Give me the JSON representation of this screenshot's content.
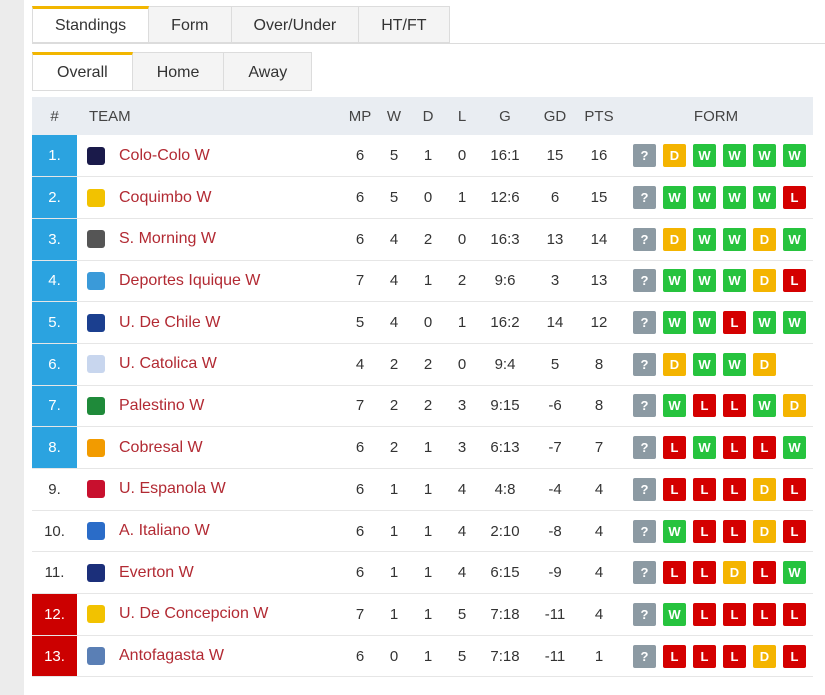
{
  "tabs": [
    "Standings",
    "Form",
    "Over/Under",
    "HT/FT"
  ],
  "subtabs": [
    "Overall",
    "Home",
    "Away"
  ],
  "headers": {
    "rank": "#",
    "team": "TEAM",
    "mp": "MP",
    "w": "W",
    "d": "D",
    "l": "L",
    "g": "G",
    "gd": "GD",
    "pts": "PTS",
    "form": "FORM"
  },
  "colors": {
    "champions": "#2ba3e0",
    "relegation": "#cc0000",
    "win": "#26c33e",
    "draw": "#f4b400",
    "loss": "#d40000",
    "next": "#8c9aa3",
    "team_link": "#b22a33"
  },
  "rows": [
    {
      "rank": "1.",
      "zone": "blue",
      "team": "Colo-Colo W",
      "logo_color": "#1a1a4a",
      "mp": "6",
      "w": "5",
      "d": "1",
      "l": "0",
      "g": "16:1",
      "gd": "15",
      "pts": "16",
      "form": [
        "?",
        "D",
        "W",
        "W",
        "W",
        "W"
      ]
    },
    {
      "rank": "2.",
      "zone": "blue",
      "team": "Coquimbo W",
      "logo_color": "#f2c200",
      "mp": "6",
      "w": "5",
      "d": "0",
      "l": "1",
      "g": "12:6",
      "gd": "6",
      "pts": "15",
      "form": [
        "?",
        "W",
        "W",
        "W",
        "W",
        "L"
      ]
    },
    {
      "rank": "3.",
      "zone": "blue",
      "team": "S. Morning W",
      "logo_color": "#555555",
      "mp": "6",
      "w": "4",
      "d": "2",
      "l": "0",
      "g": "16:3",
      "gd": "13",
      "pts": "14",
      "form": [
        "?",
        "D",
        "W",
        "W",
        "D",
        "W"
      ]
    },
    {
      "rank": "4.",
      "zone": "blue",
      "team": "Deportes Iquique W",
      "logo_color": "#3a9ad9",
      "mp": "7",
      "w": "4",
      "d": "1",
      "l": "2",
      "g": "9:6",
      "gd": "3",
      "pts": "13",
      "form": [
        "?",
        "W",
        "W",
        "W",
        "D",
        "L"
      ]
    },
    {
      "rank": "5.",
      "zone": "blue",
      "team": "U. De Chile W",
      "logo_color": "#1b3f8f",
      "mp": "5",
      "w": "4",
      "d": "0",
      "l": "1",
      "g": "16:2",
      "gd": "14",
      "pts": "12",
      "form": [
        "?",
        "W",
        "W",
        "L",
        "W",
        "W"
      ]
    },
    {
      "rank": "6.",
      "zone": "blue",
      "team": "U. Catolica W",
      "logo_color": "#c8d6ee",
      "mp": "4",
      "w": "2",
      "d": "2",
      "l": "0",
      "g": "9:4",
      "gd": "5",
      "pts": "8",
      "form": [
        "?",
        "D",
        "W",
        "W",
        "D"
      ]
    },
    {
      "rank": "7.",
      "zone": "blue",
      "team": "Palestino W",
      "logo_color": "#1f8a3a",
      "mp": "7",
      "w": "2",
      "d": "2",
      "l": "3",
      "g": "9:15",
      "gd": "-6",
      "pts": "8",
      "form": [
        "?",
        "W",
        "L",
        "L",
        "W",
        "D"
      ]
    },
    {
      "rank": "8.",
      "zone": "blue",
      "team": "Cobresal W",
      "logo_color": "#f29b00",
      "mp": "6",
      "w": "2",
      "d": "1",
      "l": "3",
      "g": "6:13",
      "gd": "-7",
      "pts": "7",
      "form": [
        "?",
        "L",
        "W",
        "L",
        "L",
        "W"
      ]
    },
    {
      "rank": "9.",
      "zone": "",
      "team": "U. Espanola W",
      "logo_color": "#c8102e",
      "mp": "6",
      "w": "1",
      "d": "1",
      "l": "4",
      "g": "4:8",
      "gd": "-4",
      "pts": "4",
      "form": [
        "?",
        "L",
        "L",
        "L",
        "D",
        "L"
      ]
    },
    {
      "rank": "10.",
      "zone": "",
      "team": "A. Italiano W",
      "logo_color": "#2a6cc8",
      "mp": "6",
      "w": "1",
      "d": "1",
      "l": "4",
      "g": "2:10",
      "gd": "-8",
      "pts": "4",
      "form": [
        "?",
        "W",
        "L",
        "L",
        "D",
        "L"
      ]
    },
    {
      "rank": "11.",
      "zone": "",
      "team": "Everton W",
      "logo_color": "#1b2f7a",
      "mp": "6",
      "w": "1",
      "d": "1",
      "l": "4",
      "g": "6:15",
      "gd": "-9",
      "pts": "4",
      "form": [
        "?",
        "L",
        "L",
        "D",
        "L",
        "W"
      ]
    },
    {
      "rank": "12.",
      "zone": "red",
      "team": "U. De Concepcion W",
      "logo_color": "#f2c200",
      "mp": "7",
      "w": "1",
      "d": "1",
      "l": "5",
      "g": "7:18",
      "gd": "-11",
      "pts": "4",
      "form": [
        "?",
        "W",
        "L",
        "L",
        "L",
        "L"
      ]
    },
    {
      "rank": "13.",
      "zone": "red",
      "team": "Antofagasta W",
      "logo_color": "#5a7fb5",
      "mp": "6",
      "w": "0",
      "d": "1",
      "l": "5",
      "g": "7:18",
      "gd": "-11",
      "pts": "1",
      "form": [
        "?",
        "L",
        "L",
        "L",
        "D",
        "L"
      ]
    }
  ]
}
